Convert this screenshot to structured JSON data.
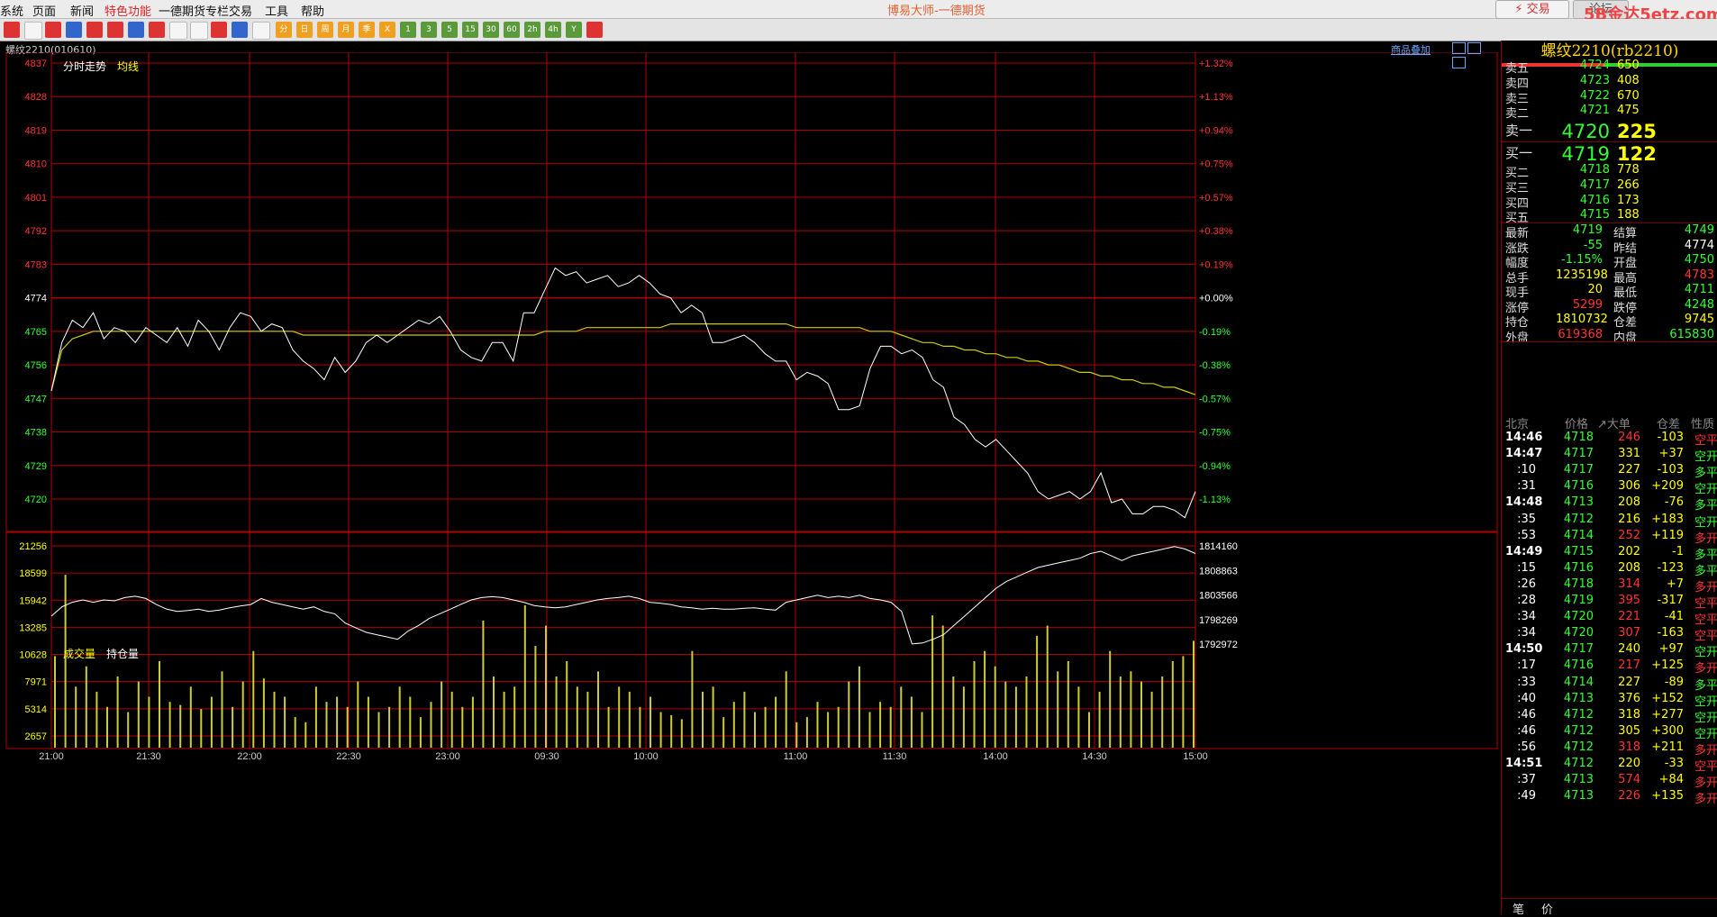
{
  "menu": {
    "items": [
      "系统",
      "页面",
      "新闻",
      "特色功能",
      "一德期货专栏",
      "交易",
      "工具",
      "帮助"
    ],
    "app_title": "博易大师-一德期货",
    "trade_button": "⚡ 交易",
    "forum_button": "论坛",
    "watermark": "5B金达5etz.com"
  },
  "toolbar": {
    "buttons": [
      "home",
      "open",
      "save",
      "refresh",
      "zoom-in",
      "zoom-out",
      "window",
      "pen",
      "eraser",
      "filter",
      "alert",
      "list",
      "chart",
      "分",
      "日",
      "周",
      "月",
      "季",
      "X",
      "1",
      "3",
      "5",
      "15",
      "30",
      "60",
      "2h",
      "4h",
      "Y",
      "calc"
    ]
  },
  "chart": {
    "title": "螺纹2210(010610)",
    "overlay_link": "商品叠加",
    "price_legend": "分时走势",
    "avg_legend": "均线",
    "vol_legend": "成交量",
    "oi_legend": "持仓量"
  },
  "colors": {
    "up": "#ff3333",
    "down": "#33ff33",
    "grid": "#b00000",
    "price": "#ffffff",
    "avg": "#cccc00",
    "volume": "#cccc33",
    "label": "#ffff00"
  },
  "chart_data": {
    "type": "line",
    "prev_settle": 4774,
    "price_ticks": [
      4837,
      4828,
      4819,
      4810,
      4801,
      4792,
      4783,
      4774,
      4765,
      4756,
      4747,
      4738,
      4729,
      4720
    ],
    "pct_ticks": [
      "+1.32%",
      "+1.13%",
      "+0.94%",
      "+0.75%",
      "+0.57%",
      "+0.38%",
      "+0.19%",
      "+0.00%",
      "-0.19%",
      "-0.38%",
      "-0.57%",
      "-0.75%",
      "-0.94%",
      "-1.13%"
    ],
    "vol_ticks": [
      "21256",
      "18599",
      "15942",
      "13285",
      "10628",
      "7971",
      "5314",
      "2657"
    ],
    "oi_ticks": [
      "1814160",
      "1808863",
      "1803566",
      "1798269",
      "1792972"
    ],
    "time_labels": [
      "21:00",
      "21:30",
      "22:00",
      "22:30",
      "23:00",
      "09:30",
      "10:00",
      "11:00",
      "11:30",
      "14:00",
      "14:30",
      "15:00"
    ],
    "price_series": [
      4749,
      4762,
      4768,
      4766,
      4770,
      4763,
      4766,
      4765,
      4762,
      4766,
      4764,
      4762,
      4766,
      4761,
      4768,
      4765,
      4760,
      4766,
      4770,
      4769,
      4765,
      4767,
      4766,
      4760,
      4757,
      4755,
      4752,
      4758,
      4754,
      4757,
      4762,
      4764,
      4762,
      4764,
      4766,
      4768,
      4767,
      4769,
      4765,
      4760,
      4758,
      4757,
      4762,
      4762,
      4757,
      4770,
      4770,
      4776,
      4782,
      4780,
      4781,
      4778,
      4779,
      4780,
      4777,
      4778,
      4780,
      4778,
      4775,
      4774,
      4770,
      4772,
      4770,
      4762,
      4762,
      4763,
      4764,
      4762,
      4759,
      4757,
      4757,
      4752,
      4754,
      4753,
      4751,
      4744,
      4744,
      4745,
      4755,
      4761,
      4761,
      4759,
      4760,
      4758,
      4752,
      4750,
      4742,
      4740,
      4736,
      4734,
      4736,
      4733,
      4730,
      4727,
      4722,
      4720,
      4721,
      4722,
      4720,
      4722,
      4727,
      4719,
      4720,
      4716,
      4716,
      4718,
      4718,
      4717,
      4715,
      4722
    ],
    "avg_series": [
      4749,
      4760,
      4763,
      4764,
      4765,
      4765,
      4765,
      4765,
      4765,
      4765,
      4765,
      4765,
      4765,
      4765,
      4765,
      4765,
      4765,
      4765,
      4765,
      4765,
      4765,
      4765,
      4765,
      4765,
      4764,
      4764,
      4764,
      4764,
      4764,
      4764,
      4764,
      4764,
      4764,
      4764,
      4764,
      4764,
      4764,
      4764,
      4764,
      4764,
      4764,
      4764,
      4764,
      4764,
      4764,
      4764,
      4764,
      4765,
      4765,
      4765,
      4765,
      4766,
      4766,
      4766,
      4766,
      4766,
      4766,
      4766,
      4766,
      4767,
      4767,
      4767,
      4767,
      4767,
      4767,
      4767,
      4767,
      4767,
      4767,
      4767,
      4767,
      4766,
      4766,
      4766,
      4766,
      4766,
      4766,
      4766,
      4765,
      4765,
      4765,
      4764,
      4763,
      4762,
      4762,
      4761,
      4761,
      4760,
      4760,
      4759,
      4759,
      4758,
      4758,
      4757,
      4757,
      4756,
      4756,
      4755,
      4754,
      4754,
      4753,
      4753,
      4752,
      4752,
      4751,
      4751,
      4750,
      4750,
      4749,
      4748
    ],
    "oi_series": [
      1799000,
      1801000,
      1802000,
      1802500,
      1802000,
      1802500,
      1802300,
      1803000,
      1803300,
      1802800,
      1801500,
      1800500,
      1800000,
      1800200,
      1800500,
      1800000,
      1800300,
      1800800,
      1801200,
      1801500,
      1802800,
      1802000,
      1801500,
      1801000,
      1800500,
      1801000,
      1800000,
      1799500,
      1797500,
      1796500,
      1795500,
      1795000,
      1794500,
      1794000,
      1795800,
      1797000,
      1798500,
      1799500,
      1800500,
      1801500,
      1802500,
      1803000,
      1803200,
      1803000,
      1802500,
      1802000,
      1801300,
      1801000,
      1800800,
      1801000,
      1801500,
      1802000,
      1802500,
      1802800,
      1803000,
      1803300,
      1802800,
      1802000,
      1801800,
      1801500,
      1801000,
      1800800,
      1800500,
      1800700,
      1800500,
      1800500,
      1800700,
      1800800,
      1800500,
      1800300,
      1802000,
      1802500,
      1803000,
      1803500,
      1803000,
      1803300,
      1803000,
      1803500,
      1802800,
      1802500,
      1802000,
      1800000,
      1793000,
      1793200,
      1794000,
      1795000,
      1797000,
      1799000,
      1801000,
      1803000,
      1805000,
      1806500,
      1807500,
      1808500,
      1809500,
      1810000,
      1810500,
      1811000,
      1811500,
      1812500,
      1813000,
      1812000,
      1811000,
      1812000,
      1812500,
      1813000,
      1813500,
      1814000,
      1813500,
      1812500
    ],
    "volume_series": [
      9000,
      17000,
      6000,
      8000,
      5500,
      4000,
      7000,
      3500,
      6500,
      5000,
      8500,
      4500,
      4200,
      6000,
      3800,
      5000,
      7500,
      4000,
      6500,
      9500,
      6800,
      5500,
      5000,
      3000,
      2500,
      6000,
      4500,
      5000,
      4000,
      6500,
      5000,
      3500,
      4000,
      6000,
      5000,
      3000,
      4500,
      6500,
      5500,
      4000,
      5000,
      12500,
      7000,
      5500,
      6000,
      14000,
      10000,
      12000,
      7000,
      8500,
      6000,
      5500,
      7500,
      4000,
      6000,
      5500,
      4000,
      5000,
      3500,
      3200,
      2800,
      9500,
      5500,
      6000,
      3000,
      4500,
      5500,
      3500,
      4000,
      5000,
      7500,
      2500,
      3000,
      4500,
      3500,
      4000,
      6500,
      8000,
      3500,
      4500,
      4000,
      6000,
      5000,
      3500,
      13000,
      12000,
      7000,
      6000,
      8500,
      9500,
      8000,
      6500,
      6000,
      7000,
      11000,
      12000,
      7500,
      8500,
      6000,
      3500,
      5500,
      9500,
      7000,
      7500,
      6500,
      5500,
      7000,
      8500,
      9000,
      10500
    ]
  },
  "right_panel": {
    "title": "螺纹2210(rb2210)",
    "asks": [
      {
        "label": "卖五",
        "price": "4724",
        "vol": "650"
      },
      {
        "label": "卖四",
        "price": "4723",
        "vol": "408"
      },
      {
        "label": "卖三",
        "price": "4722",
        "vol": "670"
      },
      {
        "label": "卖二",
        "price": "4721",
        "vol": "475"
      },
      {
        "label": "卖一",
        "price": "4720",
        "vol": "225"
      }
    ],
    "bids": [
      {
        "label": "买一",
        "price": "4719",
        "vol": "122"
      },
      {
        "label": "买二",
        "price": "4718",
        "vol": "778"
      },
      {
        "label": "买三",
        "price": "4717",
        "vol": "266"
      },
      {
        "label": "买四",
        "price": "4716",
        "vol": "173"
      },
      {
        "label": "买五",
        "price": "4715",
        "vol": "188"
      }
    ],
    "quote": [
      {
        "l1": "最新",
        "v1": "4719",
        "c1": "g",
        "l2": "结算",
        "v2": "4749",
        "c2": "g"
      },
      {
        "l1": "涨跌",
        "v1": "-55",
        "c1": "g",
        "l2": "昨结",
        "v2": "4774",
        "c2": "w"
      },
      {
        "l1": "幅度",
        "v1": "-1.15%",
        "c1": "g",
        "l2": "开盘",
        "v2": "4750",
        "c2": "g"
      },
      {
        "l1": "总手",
        "v1": "1235198",
        "c1": "y",
        "l2": "最高",
        "v2": "4783",
        "c2": "r"
      },
      {
        "l1": "现手",
        "v1": "20",
        "c1": "y",
        "l2": "最低",
        "v2": "4711",
        "c2": "g"
      },
      {
        "l1": "涨停",
        "v1": "5299",
        "c1": "r",
        "l2": "跌停",
        "v2": "4248",
        "c2": "g"
      },
      {
        "l1": "持仓",
        "v1": "1810732",
        "c1": "y",
        "l2": "仓差",
        "v2": "9745",
        "c2": "y"
      },
      {
        "l1": "外盘",
        "v1": "619368",
        "c1": "r",
        "l2": "内盘",
        "v2": "615830",
        "c2": "g"
      }
    ],
    "tick_header": {
      "time": "北京",
      "price": "价格",
      "vol": "↗大单",
      "diff": "仓差",
      "nature": "性质"
    },
    "ticks": [
      {
        "t": "14:46",
        "bold": true,
        "p": "4718",
        "pc": "g",
        "v": "246",
        "vc": "r",
        "d": "-103",
        "dc": "y",
        "n": "空平",
        "nc": "r"
      },
      {
        "t": "14:47",
        "bold": true,
        "p": "4717",
        "pc": "g",
        "v": "331",
        "vc": "y",
        "d": "+37",
        "dc": "y",
        "n": "空开",
        "nc": "g"
      },
      {
        "t": ":10",
        "bold": false,
        "p": "4717",
        "pc": "g",
        "v": "227",
        "vc": "y",
        "d": "-103",
        "dc": "y",
        "n": "多平",
        "nc": "g"
      },
      {
        "t": ":31",
        "bold": false,
        "p": "4716",
        "pc": "g",
        "v": "306",
        "vc": "y",
        "d": "+209",
        "dc": "y",
        "n": "空开",
        "nc": "g"
      },
      {
        "t": "14:48",
        "bold": true,
        "p": "4713",
        "pc": "g",
        "v": "208",
        "vc": "y",
        "d": "-76",
        "dc": "y",
        "n": "多平",
        "nc": "g"
      },
      {
        "t": ":35",
        "bold": false,
        "p": "4712",
        "pc": "g",
        "v": "216",
        "vc": "y",
        "d": "+183",
        "dc": "y",
        "n": "空开",
        "nc": "g"
      },
      {
        "t": ":53",
        "bold": false,
        "p": "4714",
        "pc": "g",
        "v": "252",
        "vc": "r",
        "d": "+119",
        "dc": "y",
        "n": "多开",
        "nc": "r"
      },
      {
        "t": "14:49",
        "bold": true,
        "p": "4715",
        "pc": "g",
        "v": "202",
        "vc": "y",
        "d": "-1",
        "dc": "y",
        "n": "多平",
        "nc": "g"
      },
      {
        "t": ":15",
        "bold": false,
        "p": "4716",
        "pc": "g",
        "v": "208",
        "vc": "y",
        "d": "-123",
        "dc": "y",
        "n": "多平",
        "nc": "g"
      },
      {
        "t": ":26",
        "bold": false,
        "p": "4718",
        "pc": "g",
        "v": "314",
        "vc": "r",
        "d": "+7",
        "dc": "y",
        "n": "多开",
        "nc": "r"
      },
      {
        "t": ":28",
        "bold": false,
        "p": "4719",
        "pc": "g",
        "v": "395",
        "vc": "r",
        "d": "-317",
        "dc": "y",
        "n": "空平",
        "nc": "r"
      },
      {
        "t": ":34",
        "bold": false,
        "p": "4720",
        "pc": "g",
        "v": "221",
        "vc": "r",
        "d": "-41",
        "dc": "y",
        "n": "空平",
        "nc": "r"
      },
      {
        "t": ":34",
        "bold": false,
        "p": "4720",
        "pc": "g",
        "v": "307",
        "vc": "r",
        "d": "-163",
        "dc": "y",
        "n": "空平",
        "nc": "r"
      },
      {
        "t": "14:50",
        "bold": true,
        "p": "4717",
        "pc": "g",
        "v": "240",
        "vc": "y",
        "d": "+97",
        "dc": "y",
        "n": "空开",
        "nc": "g"
      },
      {
        "t": ":17",
        "bold": false,
        "p": "4716",
        "pc": "g",
        "v": "217",
        "vc": "r",
        "d": "+125",
        "dc": "y",
        "n": "多开",
        "nc": "r"
      },
      {
        "t": ":33",
        "bold": false,
        "p": "4714",
        "pc": "g",
        "v": "227",
        "vc": "y",
        "d": "-89",
        "dc": "y",
        "n": "多平",
        "nc": "g"
      },
      {
        "t": ":40",
        "bold": false,
        "p": "4713",
        "pc": "g",
        "v": "376",
        "vc": "y",
        "d": "+152",
        "dc": "y",
        "n": "空开",
        "nc": "g"
      },
      {
        "t": ":46",
        "bold": false,
        "p": "4712",
        "pc": "g",
        "v": "318",
        "vc": "y",
        "d": "+277",
        "dc": "y",
        "n": "空开",
        "nc": "g"
      },
      {
        "t": ":46",
        "bold": false,
        "p": "4712",
        "pc": "g",
        "v": "305",
        "vc": "y",
        "d": "+300",
        "dc": "y",
        "n": "空开",
        "nc": "g"
      },
      {
        "t": ":56",
        "bold": false,
        "p": "4712",
        "pc": "g",
        "v": "318",
        "vc": "r",
        "d": "+211",
        "dc": "y",
        "n": "多开",
        "nc": "r"
      },
      {
        "t": "14:51",
        "bold": true,
        "p": "4712",
        "pc": "g",
        "v": "220",
        "vc": "y",
        "d": "-33",
        "dc": "y",
        "n": "空平",
        "nc": "r"
      },
      {
        "t": ":37",
        "bold": false,
        "p": "4713",
        "pc": "g",
        "v": "574",
        "vc": "r",
        "d": "+84",
        "dc": "y",
        "n": "多开",
        "nc": "r"
      },
      {
        "t": ":49",
        "bold": false,
        "p": "4713",
        "pc": "g",
        "v": "226",
        "vc": "r",
        "d": "+135",
        "dc": "y",
        "n": "多开",
        "nc": "r"
      }
    ],
    "tabs": [
      "笔",
      "价"
    ]
  }
}
